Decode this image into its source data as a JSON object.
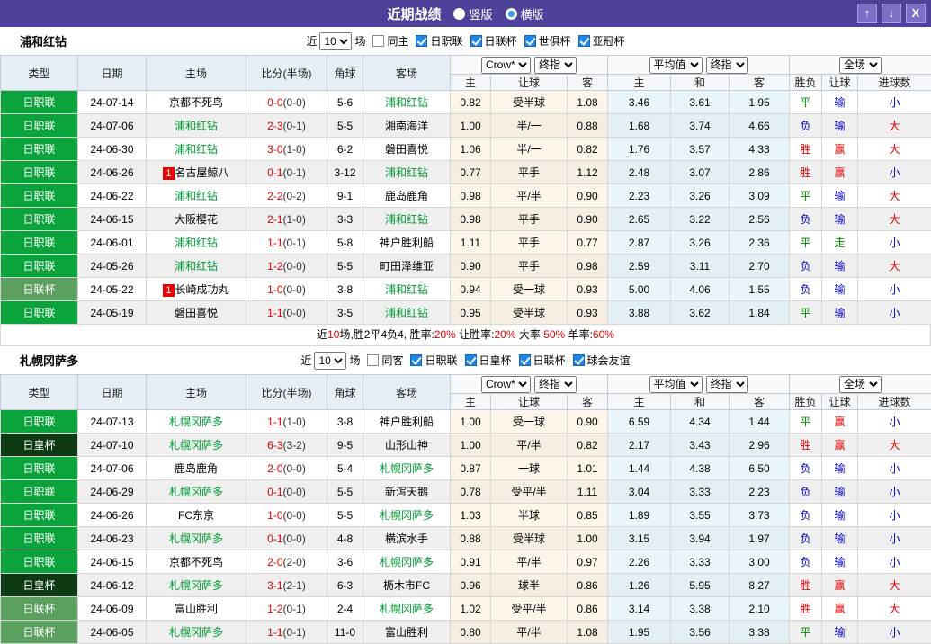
{
  "titlebar": {
    "title": "近期战绩",
    "radios": [
      {
        "label": "竖版",
        "selected": true
      },
      {
        "label": "横版",
        "selected": false
      }
    ],
    "buttons": {
      "up": "↑",
      "down": "↓",
      "close": "X"
    }
  },
  "colors": {
    "header_purple": "#4d4299",
    "league_green": "#0ba43c",
    "cup_green": "#5ba05f",
    "emperor_cup_dark": "#0d3a12",
    "self_team_green": "#009933",
    "score_red": "#e60000",
    "win_red": "#e60000",
    "draw_green": "#008800",
    "lose_blue": "#0000cc",
    "crow_tint": "#fdf4ea",
    "avg_tint": "#e9f5fa"
  },
  "headers": {
    "main": [
      "类型",
      "日期",
      "主场",
      "比分(半场)",
      "角球",
      "客场"
    ],
    "dropdowns": {
      "crow": "Crow*",
      "final1": "终指",
      "avg": "平均值",
      "final2": "终指",
      "scope": "全场"
    },
    "sub": [
      "主",
      "让球",
      "客",
      "主",
      "和",
      "客",
      "胜负",
      "让球",
      "进球数"
    ]
  },
  "filter_labels": {
    "near": "近",
    "matches": "10",
    "games": "场"
  },
  "sections": [
    {
      "team": "浦和红钻",
      "same_label": "同主",
      "same_checked": false,
      "competitions": [
        "日职联",
        "日联杯",
        "世俱杯",
        "亚冠杯"
      ],
      "rows": [
        {
          "c": "jl",
          "comp": "日职联",
          "d": "24-07-14",
          "h": "京都不死鸟",
          "hs": false,
          "hb": false,
          "ft": "0-0",
          "ht": "(0-0)",
          "cr": "5-6",
          "a": "浦和红钻",
          "as": true,
          "o": [
            "0.82",
            "受半球",
            "1.08",
            "3.46",
            "3.61",
            "1.95"
          ],
          "res": [
            [
              "平",
              "g"
            ],
            [
              "输",
              "b"
            ],
            [
              "小",
              "b"
            ]
          ]
        },
        {
          "c": "jl",
          "comp": "日职联",
          "d": "24-07-06",
          "h": "浦和红钻",
          "hs": true,
          "hb": false,
          "ft": "2-3",
          "ht": "(0-1)",
          "cr": "5-5",
          "a": "湘南海洋",
          "as": false,
          "o": [
            "1.00",
            "半/一",
            "0.88",
            "1.68",
            "3.74",
            "4.66"
          ],
          "res": [
            [
              "负",
              "b"
            ],
            [
              "输",
              "b"
            ],
            [
              "大",
              "r"
            ]
          ]
        },
        {
          "c": "jl",
          "comp": "日职联",
          "d": "24-06-30",
          "h": "浦和红钻",
          "hs": true,
          "hb": false,
          "ft": "3-0",
          "ht": "(1-0)",
          "cr": "6-2",
          "a": "磐田喜悦",
          "as": false,
          "o": [
            "1.06",
            "半/一",
            "0.82",
            "1.76",
            "3.57",
            "4.33"
          ],
          "res": [
            [
              "胜",
              "r"
            ],
            [
              "赢",
              "r"
            ],
            [
              "大",
              "r"
            ]
          ]
        },
        {
          "c": "jl",
          "comp": "日职联",
          "d": "24-06-26",
          "h": "名古屋鲸八",
          "hs": false,
          "hb": true,
          "ft": "0-1",
          "ht": "(0-1)",
          "cr": "3-12",
          "a": "浦和红钻",
          "as": true,
          "o": [
            "0.77",
            "平手",
            "1.12",
            "2.48",
            "3.07",
            "2.86"
          ],
          "res": [
            [
              "胜",
              "r"
            ],
            [
              "赢",
              "r"
            ],
            [
              "小",
              "b"
            ]
          ]
        },
        {
          "c": "jl",
          "comp": "日职联",
          "d": "24-06-22",
          "h": "浦和红钻",
          "hs": true,
          "hb": false,
          "ft": "2-2",
          "ht": "(0-2)",
          "cr": "9-1",
          "a": "鹿岛鹿角",
          "as": false,
          "o": [
            "0.98",
            "平/半",
            "0.90",
            "2.23",
            "3.26",
            "3.09"
          ],
          "res": [
            [
              "平",
              "g"
            ],
            [
              "输",
              "b"
            ],
            [
              "大",
              "r"
            ]
          ]
        },
        {
          "c": "jl",
          "comp": "日职联",
          "d": "24-06-15",
          "h": "大阪樱花",
          "hs": false,
          "hb": false,
          "ft": "2-1",
          "ht": "(1-0)",
          "cr": "3-3",
          "a": "浦和红钻",
          "as": true,
          "o": [
            "0.98",
            "平手",
            "0.90",
            "2.65",
            "3.22",
            "2.56"
          ],
          "res": [
            [
              "负",
              "b"
            ],
            [
              "输",
              "b"
            ],
            [
              "大",
              "r"
            ]
          ]
        },
        {
          "c": "jl",
          "comp": "日职联",
          "d": "24-06-01",
          "h": "浦和红钻",
          "hs": true,
          "hb": false,
          "ft": "1-1",
          "ht": "(0-1)",
          "cr": "5-8",
          "a": "神户胜利船",
          "as": false,
          "o": [
            "1.11",
            "平手",
            "0.77",
            "2.87",
            "3.26",
            "2.36"
          ],
          "res": [
            [
              "平",
              "g"
            ],
            [
              "走",
              "g"
            ],
            [
              "小",
              "b"
            ]
          ]
        },
        {
          "c": "jl",
          "comp": "日职联",
          "d": "24-05-26",
          "h": "浦和红钻",
          "hs": true,
          "hb": false,
          "ft": "1-2",
          "ht": "(0-0)",
          "cr": "5-5",
          "a": "町田泽维亚",
          "as": false,
          "o": [
            "0.90",
            "平手",
            "0.98",
            "2.59",
            "3.11",
            "2.70"
          ],
          "res": [
            [
              "负",
              "b"
            ],
            [
              "输",
              "b"
            ],
            [
              "大",
              "r"
            ]
          ]
        },
        {
          "c": "lc",
          "comp": "日联杯",
          "d": "24-05-22",
          "h": "长崎成功丸",
          "hs": false,
          "hb": true,
          "ft": "1-0",
          "ht": "(0-0)",
          "cr": "3-8",
          "a": "浦和红钻",
          "as": true,
          "o": [
            "0.94",
            "受一球",
            "0.93",
            "5.00",
            "4.06",
            "1.55"
          ],
          "res": [
            [
              "负",
              "b"
            ],
            [
              "输",
              "b"
            ],
            [
              "小",
              "b"
            ]
          ]
        },
        {
          "c": "jl",
          "comp": "日职联",
          "d": "24-05-19",
          "h": "磐田喜悦",
          "hs": false,
          "hb": false,
          "ft": "1-1",
          "ht": "(0-0)",
          "cr": "3-5",
          "a": "浦和红钻",
          "as": true,
          "o": [
            "0.95",
            "受半球",
            "0.93",
            "3.88",
            "3.62",
            "1.84"
          ],
          "res": [
            [
              "平",
              "g"
            ],
            [
              "输",
              "b"
            ],
            [
              "小",
              "b"
            ]
          ]
        }
      ],
      "summary": [
        {
          "t": "近"
        },
        {
          "t": "10",
          "red": true
        },
        {
          "t": "场,胜2平4负4, 胜率:"
        },
        {
          "t": "20%",
          "red": true
        },
        {
          "t": " 让胜率:"
        },
        {
          "t": "20%",
          "red": true
        },
        {
          "t": " 大率:"
        },
        {
          "t": "50%",
          "red": true
        },
        {
          "t": " 单率:"
        },
        {
          "t": "60%",
          "red": true
        }
      ]
    },
    {
      "team": "札幌冈萨多",
      "same_label": "同客",
      "same_checked": false,
      "competitions": [
        "日职联",
        "日皇杯",
        "日联杯",
        "球会友谊"
      ],
      "rows": [
        {
          "c": "jl",
          "comp": "日职联",
          "d": "24-07-13",
          "h": "札幌冈萨多",
          "hs": true,
          "hb": false,
          "ft": "1-1",
          "ht": "(1-0)",
          "cr": "3-8",
          "a": "神户胜利船",
          "as": false,
          "o": [
            "1.00",
            "受一球",
            "0.90",
            "6.59",
            "4.34",
            "1.44"
          ],
          "res": [
            [
              "平",
              "g"
            ],
            [
              "赢",
              "r"
            ],
            [
              "小",
              "b"
            ]
          ]
        },
        {
          "c": "ec",
          "comp": "日皇杯",
          "d": "24-07-10",
          "h": "札幌冈萨多",
          "hs": true,
          "hb": false,
          "ft": "6-3",
          "ht": "(3-2)",
          "cr": "9-5",
          "a": "山形山神",
          "as": false,
          "o": [
            "1.00",
            "平/半",
            "0.82",
            "2.17",
            "3.43",
            "2.96"
          ],
          "res": [
            [
              "胜",
              "r"
            ],
            [
              "赢",
              "r"
            ],
            [
              "大",
              "r"
            ]
          ]
        },
        {
          "c": "jl",
          "comp": "日职联",
          "d": "24-07-06",
          "h": "鹿岛鹿角",
          "hs": false,
          "hb": false,
          "ft": "2-0",
          "ht": "(0-0)",
          "cr": "5-4",
          "a": "札幌冈萨多",
          "as": true,
          "o": [
            "0.87",
            "一球",
            "1.01",
            "1.44",
            "4.38",
            "6.50"
          ],
          "res": [
            [
              "负",
              "b"
            ],
            [
              "输",
              "b"
            ],
            [
              "小",
              "b"
            ]
          ]
        },
        {
          "c": "jl",
          "comp": "日职联",
          "d": "24-06-29",
          "h": "札幌冈萨多",
          "hs": true,
          "hb": false,
          "ft": "0-1",
          "ht": "(0-0)",
          "cr": "5-5",
          "a": "新泻天鹅",
          "as": false,
          "o": [
            "0.78",
            "受平/半",
            "1.11",
            "3.04",
            "3.33",
            "2.23"
          ],
          "res": [
            [
              "负",
              "b"
            ],
            [
              "输",
              "b"
            ],
            [
              "小",
              "b"
            ]
          ]
        },
        {
          "c": "jl",
          "comp": "日职联",
          "d": "24-06-26",
          "h": "FC东京",
          "hs": false,
          "hb": false,
          "ft": "1-0",
          "ht": "(0-0)",
          "cr": "5-5",
          "a": "札幌冈萨多",
          "as": true,
          "o": [
            "1.03",
            "半球",
            "0.85",
            "1.89",
            "3.55",
            "3.73"
          ],
          "res": [
            [
              "负",
              "b"
            ],
            [
              "输",
              "b"
            ],
            [
              "小",
              "b"
            ]
          ]
        },
        {
          "c": "jl",
          "comp": "日职联",
          "d": "24-06-23",
          "h": "札幌冈萨多",
          "hs": true,
          "hb": false,
          "ft": "0-1",
          "ht": "(0-0)",
          "cr": "4-8",
          "a": "横滨水手",
          "as": false,
          "o": [
            "0.88",
            "受半球",
            "1.00",
            "3.15",
            "3.94",
            "1.97"
          ],
          "res": [
            [
              "负",
              "b"
            ],
            [
              "输",
              "b"
            ],
            [
              "小",
              "b"
            ]
          ]
        },
        {
          "c": "jl",
          "comp": "日职联",
          "d": "24-06-15",
          "h": "京都不死鸟",
          "hs": false,
          "hb": false,
          "ft": "2-0",
          "ht": "(2-0)",
          "cr": "3-6",
          "a": "札幌冈萨多",
          "as": true,
          "o": [
            "0.91",
            "平/半",
            "0.97",
            "2.26",
            "3.33",
            "3.00"
          ],
          "res": [
            [
              "负",
              "b"
            ],
            [
              "输",
              "b"
            ],
            [
              "小",
              "b"
            ]
          ]
        },
        {
          "c": "ec",
          "comp": "日皇杯",
          "d": "24-06-12",
          "h": "札幌冈萨多",
          "hs": true,
          "hb": false,
          "ft": "3-1",
          "ht": "(2-1)",
          "cr": "6-3",
          "a": "枥木市FC",
          "as": false,
          "o": [
            "0.96",
            "球半",
            "0.86",
            "1.26",
            "5.95",
            "8.27"
          ],
          "res": [
            [
              "胜",
              "r"
            ],
            [
              "赢",
              "r"
            ],
            [
              "大",
              "r"
            ]
          ]
        },
        {
          "c": "lc",
          "comp": "日联杯",
          "d": "24-06-09",
          "h": "富山胜利",
          "hs": false,
          "hb": false,
          "ft": "1-2",
          "ht": "(0-1)",
          "cr": "2-4",
          "a": "札幌冈萨多",
          "as": true,
          "o": [
            "1.02",
            "受平/半",
            "0.86",
            "3.14",
            "3.38",
            "2.10"
          ],
          "res": [
            [
              "胜",
              "r"
            ],
            [
              "赢",
              "r"
            ],
            [
              "大",
              "r"
            ]
          ]
        },
        {
          "c": "lc",
          "comp": "日联杯",
          "d": "24-06-05",
          "h": "札幌冈萨多",
          "hs": true,
          "hb": false,
          "ft": "1-1",
          "ht": "(0-1)",
          "cr": "11-0",
          "a": "富山胜利",
          "as": false,
          "o": [
            "0.80",
            "平/半",
            "1.08",
            "1.95",
            "3.56",
            "3.38"
          ],
          "res": [
            [
              "平",
              "g"
            ],
            [
              "输",
              "b"
            ],
            [
              "小",
              "b"
            ]
          ]
        }
      ],
      "summary": null
    }
  ]
}
